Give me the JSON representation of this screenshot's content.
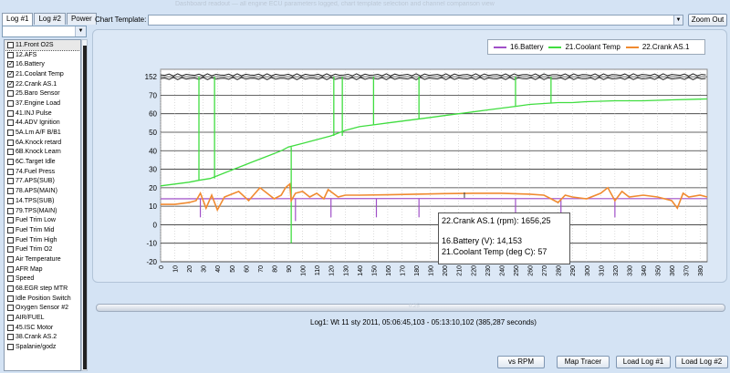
{
  "header_faded": "Dashboard readout — all engine ECU parameters logged, chart template selection and channel comparison view",
  "tabs": [
    "Log #1",
    "Log #2",
    "Power"
  ],
  "params": [
    {
      "label": "11.Front O2S",
      "checked": false,
      "selected": true
    },
    {
      "label": "12.AFS",
      "checked": false
    },
    {
      "label": "16.Battery",
      "checked": true
    },
    {
      "label": "21.Coolant Temp",
      "checked": true
    },
    {
      "label": "22.Crank AS.1",
      "checked": true
    },
    {
      "label": "25.Baro Sensor",
      "checked": false
    },
    {
      "label": "37.Engine Load",
      "checked": false
    },
    {
      "label": "41.INJ Pulse",
      "checked": false
    },
    {
      "label": "44.ADV Ignition",
      "checked": false
    },
    {
      "label": "5A.Lm A/F B/B1",
      "checked": false
    },
    {
      "label": "6A.Knock retard",
      "checked": false
    },
    {
      "label": "6B.Knock Learn",
      "checked": false
    },
    {
      "label": "6C.Target Idle",
      "checked": false
    },
    {
      "label": "74.Fuel Press",
      "checked": false
    },
    {
      "label": "77.APS(SUB)",
      "checked": false
    },
    {
      "label": "78.APS(MAIN)",
      "checked": false
    },
    {
      "label": "14.TPS(SUB)",
      "checked": false
    },
    {
      "label": "79.TPS(MAIN)",
      "checked": false
    },
    {
      "label": "Fuel Trim Low",
      "checked": false
    },
    {
      "label": "Fuel Trim Mid",
      "checked": false
    },
    {
      "label": "Fuel Trim High",
      "checked": false
    },
    {
      "label": "Fuel Trim O2",
      "checked": false
    },
    {
      "label": "Air Temperature",
      "checked": false
    },
    {
      "label": "AFR Map",
      "checked": false
    },
    {
      "label": "Speed",
      "checked": false
    },
    {
      "label": "68.EGR step MTR",
      "checked": false
    },
    {
      "label": "Idle Position Switch",
      "checked": false
    },
    {
      "label": "Oxygen Sensor #2",
      "checked": false
    },
    {
      "label": "AIR/FUEL",
      "checked": false
    },
    {
      "label": "45.ISC Motor",
      "checked": false
    },
    {
      "label": "38.Crank AS.2",
      "checked": false
    },
    {
      "label": "Spalanie/godz",
      "checked": false
    }
  ],
  "toolbar": {
    "template_label": "Chart Template:",
    "zoom_out": "Zoom Out"
  },
  "chart_data": {
    "type": "line",
    "x": {
      "min": 0,
      "max": 385,
      "ticks": [
        0,
        10,
        20,
        30,
        40,
        50,
        60,
        70,
        80,
        90,
        100,
        110,
        120,
        130,
        140,
        150,
        160,
        170,
        180,
        190,
        200,
        210,
        220,
        230,
        240,
        250,
        260,
        270,
        280,
        290,
        300,
        310,
        320,
        330,
        340,
        350,
        360,
        370,
        380
      ]
    },
    "y_ticks": [
      -20,
      -10,
      0,
      10,
      20,
      30,
      40,
      50,
      60,
      70,
      152
    ],
    "series": [
      {
        "name": "16.Battery",
        "color": "#a050c8",
        "points": [
          [
            0,
            14
          ],
          [
            100,
            14.1
          ],
          [
            200,
            14.15
          ],
          [
            300,
            14.1
          ],
          [
            385,
            14.1
          ]
        ],
        "dips": [
          [
            28,
            4
          ],
          [
            95,
            2
          ],
          [
            120,
            4
          ],
          [
            152,
            4
          ],
          [
            182,
            4
          ],
          [
            250,
            2
          ],
          [
            282,
            4
          ],
          [
            320,
            4
          ]
        ]
      },
      {
        "name": "21.Coolant Temp",
        "color": "#40dd40",
        "points": [
          [
            0,
            21
          ],
          [
            10,
            22
          ],
          [
            20,
            23
          ],
          [
            27,
            24
          ],
          [
            35,
            25
          ],
          [
            45,
            28
          ],
          [
            55,
            31
          ],
          [
            65,
            34
          ],
          [
            75,
            37
          ],
          [
            85,
            40
          ],
          [
            90,
            42
          ],
          [
            100,
            44
          ],
          [
            110,
            46
          ],
          [
            120,
            48
          ],
          [
            130,
            51
          ],
          [
            140,
            53
          ],
          [
            150,
            54
          ],
          [
            160,
            55
          ],
          [
            170,
            56
          ],
          [
            180,
            57
          ],
          [
            190,
            58
          ],
          [
            200,
            59
          ],
          [
            210,
            60
          ],
          [
            220,
            61
          ],
          [
            230,
            62
          ],
          [
            240,
            63
          ],
          [
            250,
            64
          ],
          [
            260,
            65
          ],
          [
            270,
            65.5
          ],
          [
            280,
            66
          ],
          [
            290,
            66
          ],
          [
            300,
            66.5
          ],
          [
            320,
            67
          ],
          [
            340,
            67
          ],
          [
            360,
            67.5
          ],
          [
            385,
            68
          ]
        ],
        "spikes": [
          [
            27,
            152
          ],
          [
            38,
            152
          ],
          [
            92,
            -10
          ],
          [
            122,
            152
          ],
          [
            128,
            152
          ],
          [
            150,
            152
          ],
          [
            182,
            152
          ],
          [
            250,
            152
          ],
          [
            275,
            152
          ]
        ]
      },
      {
        "name": "22.Crank AS.1",
        "color": "#f08a30",
        "points": [
          [
            0,
            11
          ],
          [
            10,
            11
          ],
          [
            20,
            12
          ],
          [
            25,
            13
          ],
          [
            28,
            17
          ],
          [
            32,
            9
          ],
          [
            36,
            16
          ],
          [
            40,
            8
          ],
          [
            45,
            15
          ],
          [
            55,
            18
          ],
          [
            62,
            13
          ],
          [
            70,
            20
          ],
          [
            75,
            17
          ],
          [
            80,
            14
          ],
          [
            85,
            16
          ],
          [
            88,
            20
          ],
          [
            91,
            22
          ],
          [
            92,
            13
          ],
          [
            95,
            17
          ],
          [
            100,
            18
          ],
          [
            105,
            15
          ],
          [
            110,
            17
          ],
          [
            115,
            14
          ],
          [
            118,
            19
          ],
          [
            125,
            15
          ],
          [
            130,
            16
          ],
          [
            140,
            16
          ],
          [
            160,
            16.2
          ],
          [
            180,
            16.5
          ],
          [
            200,
            16.8
          ],
          [
            220,
            17
          ],
          [
            240,
            17
          ],
          [
            260,
            16.5
          ],
          [
            270,
            16
          ],
          [
            275,
            14
          ],
          [
            280,
            12
          ],
          [
            285,
            16
          ],
          [
            290,
            15
          ],
          [
            300,
            14
          ],
          [
            310,
            17
          ],
          [
            315,
            20
          ],
          [
            320,
            13
          ],
          [
            325,
            18
          ],
          [
            330,
            15
          ],
          [
            340,
            16
          ],
          [
            350,
            15
          ],
          [
            360,
            13
          ],
          [
            364,
            9
          ],
          [
            368,
            17
          ],
          [
            372,
            15
          ],
          [
            380,
            16
          ],
          [
            385,
            15
          ]
        ]
      }
    ],
    "upper_band": {
      "value": 152
    },
    "legend": [
      "16.Battery",
      "21.Coolant Temp",
      "22.Crank AS.1"
    ]
  },
  "tooltip": {
    "line1": "22.Crank AS.1 (rpm): 1656,25",
    "line2": "16.Battery (V): 14,153",
    "line3": "21.Coolant Temp (deg C): 57"
  },
  "timeline": {
    "value": "0.25"
  },
  "log_info": "Log1: Wt 11 sty 2011,   05:06:45,103 - 05:13:10,102 (385,287 seconds)",
  "buttons": {
    "vs_rpm": "vs RPM",
    "map_tracer": "Map Tracer",
    "load_log1": "Load Log #1",
    "load_log2": "Load Log #2"
  }
}
